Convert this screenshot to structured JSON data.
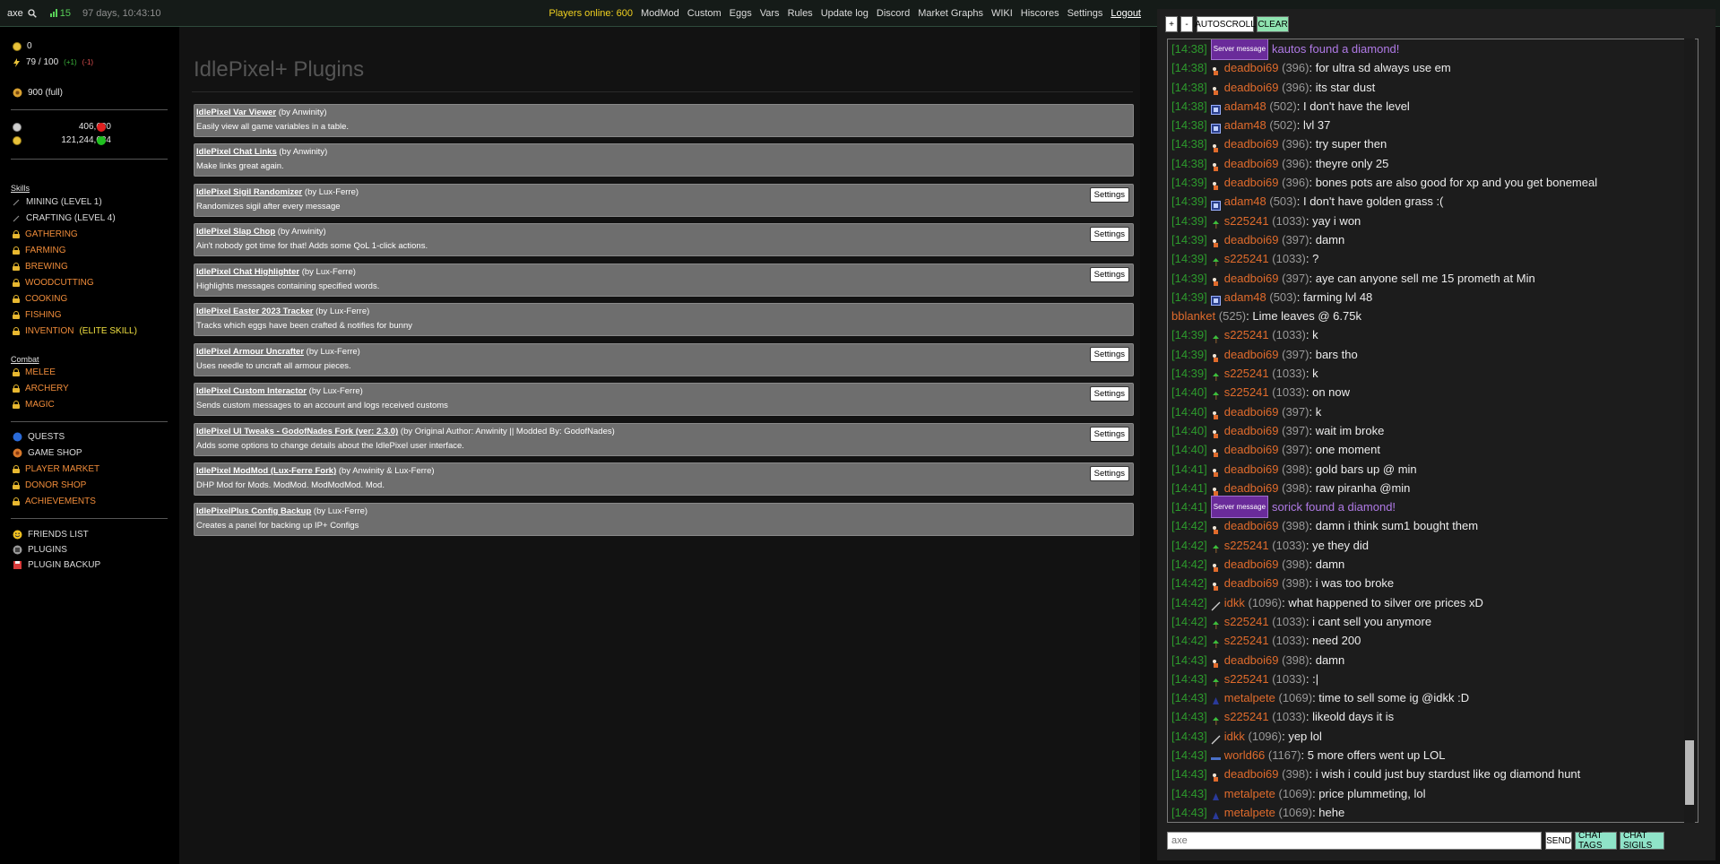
{
  "topbar": {
    "username": "axe",
    "signal_count": "15",
    "game_time": "97 days, 10:43:10",
    "players_online": "Players online: 600",
    "links": [
      "ModMod",
      "Custom",
      "Eggs",
      "Vars",
      "Rules",
      "Update log",
      "Discord",
      "Market Graphs",
      "WIKI",
      "Hiscores",
      "Settings",
      "Logout"
    ]
  },
  "sidebar": {
    "gold": "0",
    "energy": "79 / 100",
    "energy_up": "(+1)",
    "energy_down": "(-1)",
    "pie": "900 (full)",
    "silver_amount": "406,680",
    "gold_amount": "121,244,684",
    "status_colors": [
      "#e02020",
      "#20c020"
    ],
    "skills_header": "Skills",
    "skills": [
      {
        "label": "MINING (LEVEL 1)",
        "locked": false
      },
      {
        "label": "CRAFTING (LEVEL 4)",
        "locked": false
      },
      {
        "label": "GATHERING",
        "locked": true
      },
      {
        "label": "FARMING",
        "locked": true
      },
      {
        "label": "BREWING",
        "locked": true
      },
      {
        "label": "WOODCUTTING",
        "locked": true
      },
      {
        "label": "COOKING",
        "locked": true
      },
      {
        "label": "FISHING",
        "locked": true
      },
      {
        "label": "INVENTION",
        "locked": true,
        "extra": "(ELITE SKILL)"
      }
    ],
    "combat_header": "Combat",
    "combat": [
      "MELEE",
      "ARCHERY",
      "MAGIC"
    ],
    "misc": [
      {
        "label": "QUESTS",
        "icon": "quest-icon",
        "locked": false
      },
      {
        "label": "GAME SHOP",
        "icon": "shop-icon",
        "locked": false
      },
      {
        "label": "PLAYER MARKET",
        "icon": "lock-icon",
        "locked": true
      },
      {
        "label": "DONOR SHOP",
        "icon": "lock-icon",
        "locked": true
      },
      {
        "label": "ACHIEVEMENTS",
        "icon": "lock-icon",
        "locked": true
      }
    ],
    "social": [
      {
        "label": "FRIENDS LIST",
        "icon": "smiley-icon"
      },
      {
        "label": "PLUGINS",
        "icon": "plugin-icon"
      },
      {
        "label": "PLUGIN BACKUP",
        "icon": "backup-icon"
      }
    ]
  },
  "main": {
    "title": "IdlePixel+ Plugins",
    "settings_label": "Settings",
    "plugins": [
      {
        "name": "IdlePixel Var Viewer",
        "author": " (by Anwinity)",
        "desc": "Easily view all game variables in a table.",
        "settings": false
      },
      {
        "name": "IdlePixel Chat Links",
        "author": " (by Anwinity)",
        "desc": "Make links great again.",
        "settings": false
      },
      {
        "name": "IdlePixel Sigil Randomizer",
        "author": " (by Lux-Ferre)",
        "desc": "Randomizes sigil after every message",
        "settings": true
      },
      {
        "name": "IdlePixel Slap Chop",
        "author": " (by Anwinity)",
        "desc": "Ain't nobody got time for that! Adds some QoL 1-click actions.",
        "settings": true
      },
      {
        "name": "IdlePixel Chat Highlighter",
        "author": " (by Lux-Ferre)",
        "desc": "Highlights messages containing specified words.",
        "settings": true
      },
      {
        "name": "IdlePixel Easter 2023 Tracker",
        "author": " (by Lux-Ferre)",
        "desc": "Tracks which eggs have been crafted & notifies for bunny",
        "settings": false
      },
      {
        "name": "IdlePixel Armour Uncrafter",
        "author": " (by Lux-Ferre)",
        "desc": "Uses needle to uncraft all armour pieces.",
        "settings": true
      },
      {
        "name": "IdlePixel Custom Interactor",
        "author": " (by Lux-Ferre)",
        "desc": "Sends custom messages to an account and logs received customs",
        "settings": true
      },
      {
        "name": "IdlePixel UI Tweaks - GodofNades Fork (ver: 2.3.0)",
        "author": " (by Original Author: Anwinity || Modded By: GodofNades)",
        "desc": "Adds some options to change details about the IdlePixel user interface.",
        "settings": true
      },
      {
        "name": "IdlePixel ModMod (Lux-Ferre Fork)",
        "author": " (by Anwinity & Lux-Ferre)",
        "desc": "DHP Mod for Mods. ModMod. ModModMod. Mod.",
        "settings": true
      },
      {
        "name": "IdlePixelPlus Config Backup",
        "author": " (by Lux-Ferre)",
        "desc": "Creates a panel for backing up IP+ Configs",
        "settings": false
      }
    ]
  },
  "chat": {
    "buttons": {
      "plus": "+",
      "minus": "-",
      "autoscroll": "AUTOSCROLL",
      "clear": "CLEAR"
    },
    "server_tag": "Server message",
    "messages": [
      {
        "time": "[14:38]",
        "server": true,
        "text": "kautos found a diamond!"
      },
      {
        "time": "[14:38]",
        "user": "deadboi69",
        "level": "(396)",
        "text": "for ultra sd always use em",
        "sigil": "deadboi"
      },
      {
        "time": "[14:38]",
        "user": "deadboi69",
        "level": "(396)",
        "text": "its star dust",
        "sigil": "deadboi"
      },
      {
        "time": "[14:38]",
        "user": "adam48",
        "level": "(502)",
        "text": "I don't have the level",
        "sigil": "adam"
      },
      {
        "time": "[14:38]",
        "user": "adam48",
        "level": "(502)",
        "text": "lvl 37",
        "sigil": "adam"
      },
      {
        "time": "[14:38]",
        "user": "deadboi69",
        "level": "(396)",
        "text": "try super then",
        "sigil": "deadboi"
      },
      {
        "time": "[14:38]",
        "user": "deadboi69",
        "level": "(396)",
        "text": "theyre only 25",
        "sigil": "deadboi"
      },
      {
        "time": "[14:39]",
        "user": "deadboi69",
        "level": "(396)",
        "text": "bones pots are also good for xp and you get bonemeal",
        "sigil": "deadboi"
      },
      {
        "time": "[14:39]",
        "user": "adam48",
        "level": "(503)",
        "text": "I don't have golden grass :(",
        "sigil": "adam"
      },
      {
        "time": "[14:39]",
        "user": "s225241",
        "level": "(1033)",
        "text": "yay i won",
        "sigil": "s2"
      },
      {
        "time": "[14:39]",
        "user": "deadboi69",
        "level": "(397)",
        "text": "damn",
        "sigil": "deadboi"
      },
      {
        "time": "[14:39]",
        "user": "s225241",
        "level": "(1033)",
        "text": "?",
        "sigil": "s2"
      },
      {
        "time": "[14:39]",
        "user": "deadboi69",
        "level": "(397)",
        "text": "aye can anyone sell me 15 prometh at Min",
        "sigil": "deadboi"
      },
      {
        "time": "[14:39]",
        "user": "adam48",
        "level": "(503)",
        "text": "farming lvl 48",
        "sigil": "adam"
      },
      {
        "time": "",
        "user": "bblanket",
        "level": "(525)",
        "text": "Lime leaves @ 6.75k",
        "sigil": ""
      },
      {
        "time": "[14:39]",
        "user": "s225241",
        "level": "(1033)",
        "text": "k",
        "sigil": "s2"
      },
      {
        "time": "[14:39]",
        "user": "deadboi69",
        "level": "(397)",
        "text": "bars tho",
        "sigil": "deadboi"
      },
      {
        "time": "[14:39]",
        "user": "s225241",
        "level": "(1033)",
        "text": "k",
        "sigil": "s2"
      },
      {
        "time": "[14:40]",
        "user": "s225241",
        "level": "(1033)",
        "text": "on now",
        "sigil": "s2"
      },
      {
        "time": "[14:40]",
        "user": "deadboi69",
        "level": "(397)",
        "text": "k",
        "sigil": "deadboi"
      },
      {
        "time": "[14:40]",
        "user": "deadboi69",
        "level": "(397)",
        "text": "wait im broke",
        "sigil": "deadboi"
      },
      {
        "time": "[14:40]",
        "user": "deadboi69",
        "level": "(397)",
        "text": "one moment",
        "sigil": "deadboi"
      },
      {
        "time": "[14:41]",
        "user": "deadboi69",
        "level": "(398)",
        "text": "gold bars up @ min",
        "sigil": "deadboi"
      },
      {
        "time": "[14:41]",
        "user": "deadboi69",
        "level": "(398)",
        "text": "raw piranha @min",
        "sigil": "deadboi"
      },
      {
        "time": "[14:41]",
        "server": true,
        "text": "sorick found a diamond!"
      },
      {
        "time": "[14:42]",
        "user": "deadboi69",
        "level": "(398)",
        "text": "damn i think sum1 bought them",
        "sigil": "deadboi"
      },
      {
        "time": "[14:42]",
        "user": "s225241",
        "level": "(1033)",
        "text": "ye they did",
        "sigil": "s2"
      },
      {
        "time": "[14:42]",
        "user": "deadboi69",
        "level": "(398)",
        "text": "damn",
        "sigil": "deadboi"
      },
      {
        "time": "[14:42]",
        "user": "deadboi69",
        "level": "(398)",
        "text": "i was too broke",
        "sigil": "deadboi"
      },
      {
        "time": "[14:42]",
        "user": "idkk",
        "level": "(1096)",
        "text": "what happened to silver ore prices xD",
        "sigil": "idkk"
      },
      {
        "time": "[14:42]",
        "user": "s225241",
        "level": "(1033)",
        "text": "i cant sell you anymore",
        "sigil": "s2"
      },
      {
        "time": "[14:42]",
        "user": "s225241",
        "level": "(1033)",
        "text": "need 200",
        "sigil": "s2"
      },
      {
        "time": "[14:43]",
        "user": "deadboi69",
        "level": "(398)",
        "text": "damn",
        "sigil": "deadboi"
      },
      {
        "time": "[14:43]",
        "user": "s225241",
        "level": "(1033)",
        "text": ":|",
        "sigil": "s2"
      },
      {
        "time": "[14:43]",
        "user": "metalpete",
        "level": "(1069)",
        "text": "time to sell some ig @idkk :D",
        "sigil": "metal"
      },
      {
        "time": "[14:43]",
        "user": "s225241",
        "level": "(1033)",
        "text": "likeold days it is",
        "sigil": "s2"
      },
      {
        "time": "[14:43]",
        "user": "idkk",
        "level": "(1096)",
        "text": "yep lol",
        "sigil": "idkk"
      },
      {
        "time": "[14:43]",
        "user": "world66",
        "level": "(1167)",
        "text": "5 more offers went up LOL",
        "sigil": "world"
      },
      {
        "time": "[14:43]",
        "user": "deadboi69",
        "level": "(398)",
        "text": "i wish i could just buy stardust like og diamond hunt",
        "sigil": "deadboi"
      },
      {
        "time": "[14:43]",
        "user": "metalpete",
        "level": "(1069)",
        "text": "price plummeting, lol",
        "sigil": "metal"
      },
      {
        "time": "[14:43]",
        "user": "metalpete",
        "level": "(1069)",
        "text": "hehe",
        "sigil": "metal"
      }
    ],
    "input_placeholder": "axe",
    "send_label": "SEND",
    "tags_label": "CHAT TAGS",
    "sigils_label": "CHAT SIGILS"
  }
}
